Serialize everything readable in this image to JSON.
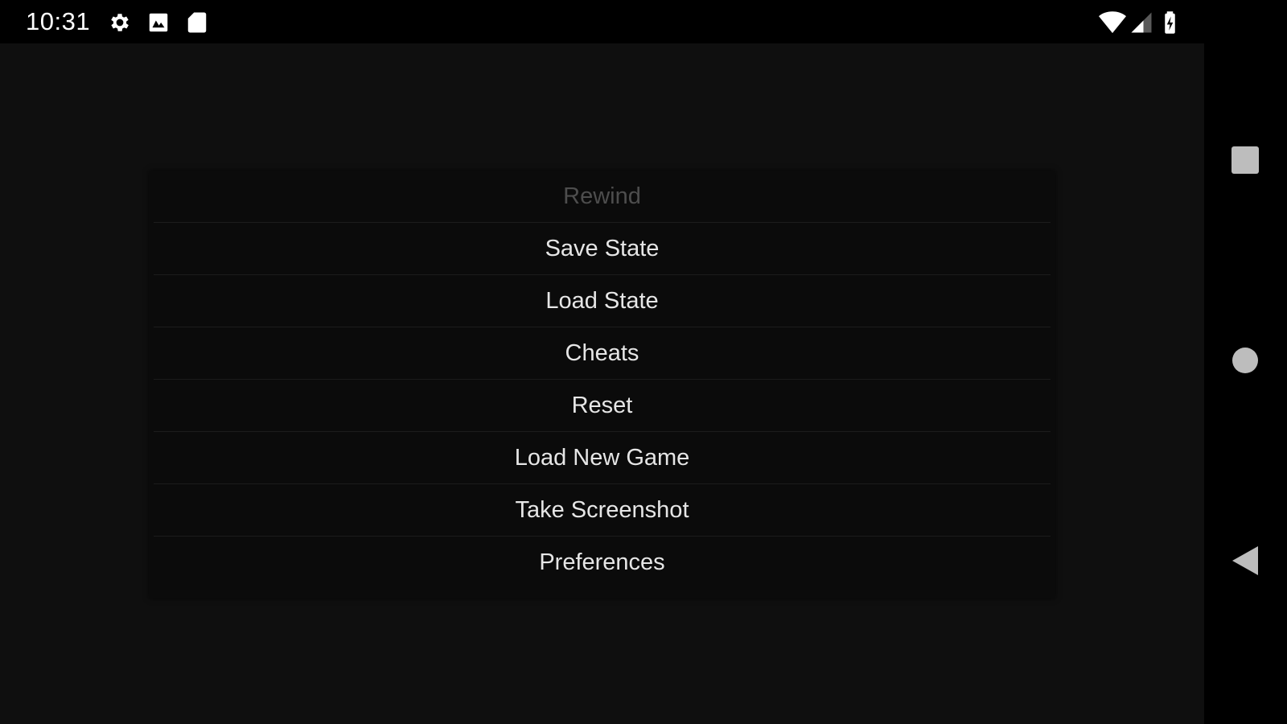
{
  "status_bar": {
    "time": "10:31",
    "left_icons": [
      "gear-icon",
      "image-notification-icon",
      "sd-card-icon"
    ],
    "right_icons": [
      "wifi-icon",
      "cell-signal-icon",
      "battery-icon"
    ],
    "icon_color": "#ffffff"
  },
  "menu": {
    "items": [
      {
        "label": "Rewind",
        "enabled": false
      },
      {
        "label": "Save State",
        "enabled": true
      },
      {
        "label": "Load State",
        "enabled": true
      },
      {
        "label": "Cheats",
        "enabled": true
      },
      {
        "label": "Reset",
        "enabled": true
      },
      {
        "label": "Load New Game",
        "enabled": true
      },
      {
        "label": "Take Screenshot",
        "enabled": true
      },
      {
        "label": "Preferences",
        "enabled": true
      }
    ]
  },
  "nav_bar": {
    "buttons": [
      "recents-square-icon",
      "home-circle-icon",
      "back-triangle-icon"
    ],
    "icon_color": "#bdbdbd"
  },
  "colors": {
    "background": "#0f0f0f",
    "menu_background": "#0b0b0b",
    "enabled_text": "#e6e6e6",
    "disabled_text": "#4d4d4d"
  }
}
